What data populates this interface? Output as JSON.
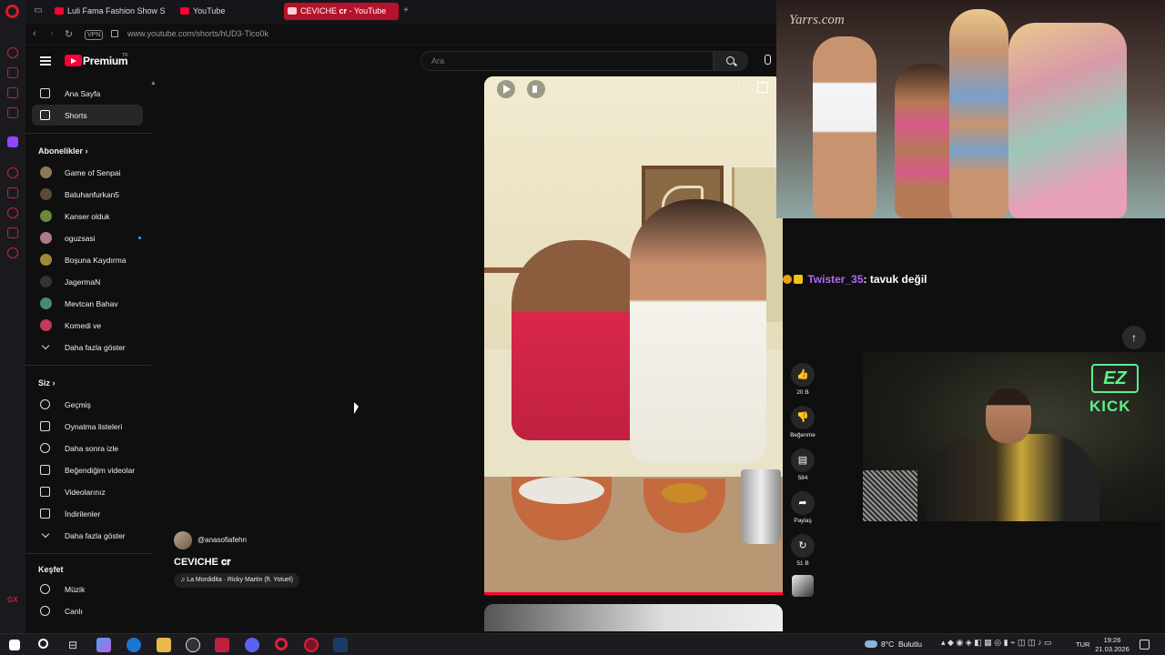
{
  "browser": {
    "tabs": [
      {
        "label": "Luli Fama Fashion Show S"
      },
      {
        "label": "YouTube"
      },
      {
        "label": "CEVICHE 𝐜𝐫 - YouTube",
        "active": true
      }
    ],
    "new_tab_label": "+",
    "vpn_label": "VPN",
    "url": "www.youtube.com/shorts/hUD3-Tlco0k"
  },
  "youtube": {
    "brand": "Premium",
    "region": "TR",
    "search": {
      "placeholder": "Ara",
      "value": ""
    }
  },
  "sidebar": {
    "main": [
      {
        "label": "Ana Sayfa",
        "icon": "home-icon"
      },
      {
        "label": "Shorts",
        "icon": "shorts-icon",
        "active": true
      }
    ],
    "subscriptions_header": "Abonelikler",
    "subscriptions": [
      {
        "label": "Game of Senpai",
        "avatar_color": "#8a7a5a"
      },
      {
        "label": "Batuhanfurkan5",
        "avatar_color": "#5a4a3a"
      },
      {
        "label": "Kanser olduk",
        "avatar_color": "#6a8a3a"
      },
      {
        "label": "oguzsasi",
        "avatar_color": "#b07a8a",
        "new_content": true
      },
      {
        "label": "Boşuna Kaydırma",
        "avatar_color": "#a08a3a"
      },
      {
        "label": "JagermaN",
        "avatar_color": "#333333"
      },
      {
        "label": "Mevtcan Bahav",
        "avatar_color": "#4a8a6a"
      },
      {
        "label": "Komedi ve",
        "avatar_color": "#c03a5a"
      }
    ],
    "show_more_1": "Daha fazla göster",
    "you_header": "Siz",
    "you": [
      {
        "label": "Geçmiş",
        "icon": "history-icon"
      },
      {
        "label": "Oynatma listeleri",
        "icon": "playlist-icon"
      },
      {
        "label": "Daha sonra izle",
        "icon": "clock-icon"
      },
      {
        "label": "Beğendiğim videolar",
        "icon": "thumbs-up-icon"
      },
      {
        "label": "Videolarınız",
        "icon": "video-icon"
      },
      {
        "label": "İndirilenler",
        "icon": "download-icon"
      }
    ],
    "show_more_2": "Daha fazla göster",
    "explore_header": "Keşfet",
    "explore": [
      {
        "label": "Müzik",
        "icon": "music-icon"
      },
      {
        "label": "Canlı",
        "icon": "live-icon"
      }
    ]
  },
  "short": {
    "channel": "@anasofiafehn",
    "title": "CEVICHE 𝐜𝐫",
    "music": "♫ La Mordidita · Ricky Martin (ft. Yotuel)",
    "actions": [
      {
        "icon": "like-icon",
        "glyph": "👍",
        "label": "20 B"
      },
      {
        "icon": "dislike-icon",
        "glyph": "👎",
        "label": "Beğenme"
      },
      {
        "icon": "comment-icon",
        "glyph": "▤",
        "label": "584"
      },
      {
        "icon": "share-icon",
        "glyph": "➦",
        "label": "Paylaş"
      },
      {
        "icon": "remix-icon",
        "glyph": "↻",
        "label": "51 B"
      }
    ]
  },
  "stream": {
    "runway_watermark": "Yarrs.com",
    "chat": {
      "user": "Twister_35",
      "message": ": tavuk değil"
    },
    "neon_top": "EZ",
    "neon_bottom": "KICK"
  },
  "taskbar": {
    "weather_temp": "8°C",
    "weather_desc": "Bulutlu",
    "language": "TUR",
    "time": "19:26",
    "date": "21.03.2026"
  }
}
